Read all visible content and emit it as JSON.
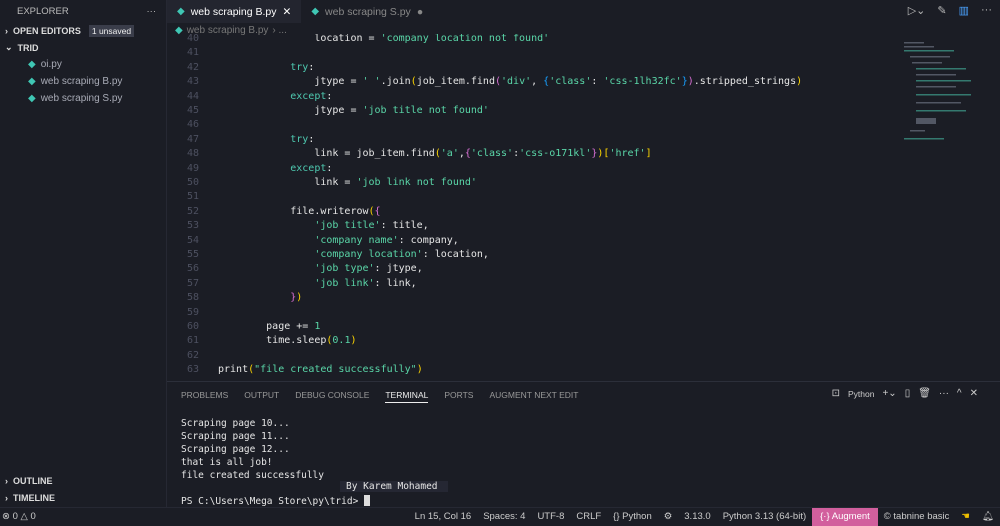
{
  "sidebar": {
    "title": "EXPLORER",
    "more": "···",
    "open_editors": "OPEN EDITORS",
    "unsaved_badge": "1 unsaved",
    "folder": "TRID",
    "files": [
      "oi.py",
      "web scraping B.py",
      "web scraping S.py"
    ],
    "outline": "OUTLINE",
    "timeline": "TIMELINE"
  },
  "tabs": [
    {
      "label": "web scraping B.py",
      "close": "✕"
    },
    {
      "label": "web scraping S.py",
      "dirty": "●"
    }
  ],
  "breadcrumb": {
    "file": "web scraping B.py",
    "rest": "› ..."
  },
  "code": [
    {
      "n": "40",
      "t": [
        [
          "                location = ",
          "n"
        ],
        [
          "'company location not found'",
          "s"
        ]
      ]
    },
    {
      "n": "41",
      "t": []
    },
    {
      "n": "42",
      "t": [
        [
          "            try",
          "k"
        ],
        [
          ":",
          "n"
        ]
      ]
    },
    {
      "n": "43",
      "t": [
        [
          "                jtype = ",
          "n"
        ],
        [
          "' '",
          "s"
        ],
        [
          ".join",
          "n"
        ],
        [
          "(",
          "p1"
        ],
        [
          "job_item.find",
          "n"
        ],
        [
          "(",
          "p2"
        ],
        [
          "'div'",
          "s"
        ],
        [
          ", ",
          "n"
        ],
        [
          "{",
          "p3"
        ],
        [
          "'class'",
          "s"
        ],
        [
          ": ",
          "n"
        ],
        [
          "'css-1lh32fc'",
          "s"
        ],
        [
          "}",
          "p3"
        ],
        [
          ")",
          "p2"
        ],
        [
          ".stripped_strings",
          "n"
        ],
        [
          ")",
          "p1"
        ]
      ]
    },
    {
      "n": "44",
      "t": [
        [
          "            except",
          "k"
        ],
        [
          ":",
          "n"
        ]
      ]
    },
    {
      "n": "45",
      "t": [
        [
          "                jtype = ",
          "n"
        ],
        [
          "'job title not found'",
          "s"
        ]
      ]
    },
    {
      "n": "46",
      "t": []
    },
    {
      "n": "47",
      "t": [
        [
          "            try",
          "k"
        ],
        [
          ":",
          "n"
        ]
      ]
    },
    {
      "n": "48",
      "t": [
        [
          "                link = job_item.find",
          "n"
        ],
        [
          "(",
          "p1"
        ],
        [
          "'a'",
          "s"
        ],
        [
          ",",
          "n"
        ],
        [
          "{",
          "p2"
        ],
        [
          "'class'",
          "s"
        ],
        [
          ":",
          "n"
        ],
        [
          "'css-o171kl'",
          "s"
        ],
        [
          "}",
          "p2"
        ],
        [
          ")",
          "p1"
        ],
        [
          "[",
          "p1"
        ],
        [
          "'href'",
          "s"
        ],
        [
          "]",
          "p1"
        ]
      ]
    },
    {
      "n": "49",
      "t": [
        [
          "            except",
          "k"
        ],
        [
          ":",
          "n"
        ]
      ]
    },
    {
      "n": "50",
      "t": [
        [
          "                link = ",
          "n"
        ],
        [
          "'job link not found'",
          "s"
        ]
      ]
    },
    {
      "n": "51",
      "t": []
    },
    {
      "n": "52",
      "t": [
        [
          "            file.writerow",
          "n"
        ],
        [
          "(",
          "p1"
        ],
        [
          "{",
          "p2"
        ]
      ]
    },
    {
      "n": "53",
      "t": [
        [
          "                ",
          "n"
        ],
        [
          "'job title'",
          "s"
        ],
        [
          ": title,",
          "n"
        ]
      ]
    },
    {
      "n": "54",
      "t": [
        [
          "                ",
          "n"
        ],
        [
          "'company name'",
          "s"
        ],
        [
          ": company,",
          "n"
        ]
      ]
    },
    {
      "n": "55",
      "t": [
        [
          "                ",
          "n"
        ],
        [
          "'company location'",
          "s"
        ],
        [
          ": location,",
          "n"
        ]
      ]
    },
    {
      "n": "56",
      "t": [
        [
          "                ",
          "n"
        ],
        [
          "'job type'",
          "s"
        ],
        [
          ": jtype,",
          "n"
        ]
      ]
    },
    {
      "n": "57",
      "t": [
        [
          "                ",
          "n"
        ],
        [
          "'job link'",
          "s"
        ],
        [
          ": link,",
          "n"
        ]
      ]
    },
    {
      "n": "58",
      "t": [
        [
          "            ",
          "n"
        ],
        [
          "}",
          "p2"
        ],
        [
          ")",
          "p1"
        ]
      ]
    },
    {
      "n": "59",
      "t": []
    },
    {
      "n": "60",
      "t": [
        [
          "        page += ",
          "n"
        ],
        [
          "1",
          "num"
        ]
      ]
    },
    {
      "n": "61",
      "t": [
        [
          "        time.sleep",
          "n"
        ],
        [
          "(",
          "p1"
        ],
        [
          "0.1",
          "num"
        ],
        [
          ")",
          "p1"
        ]
      ]
    },
    {
      "n": "62",
      "t": []
    },
    {
      "n": "63",
      "t": [
        [
          "print",
          "n"
        ],
        [
          "(",
          "p1"
        ],
        [
          "\"file created successfully\"",
          "s"
        ],
        [
          ")",
          "p1"
        ]
      ]
    }
  ],
  "panel": {
    "tabs": [
      "PROBLEMS",
      "OUTPUT",
      "DEBUG CONSOLE",
      "TERMINAL",
      "PORTS",
      "AUGMENT NEXT EDIT"
    ],
    "active": "TERMINAL",
    "shell": "Python",
    "lines": [
      "Scraping page 10...",
      "Scraping page 11...",
      "Scraping page 12...",
      "that is all job!",
      "file created successfully"
    ],
    "tooltip": "By Karem Mohamed",
    "prompt": "PS C:\\Users\\Mega Store\\py\\trid> "
  },
  "status": {
    "errors": "0",
    "warnings": "0",
    "position": "Ln 15, Col 16",
    "spaces": "Spaces: 4",
    "encoding": "UTF-8",
    "eol": "CRLF",
    "language": "{} Python",
    "version": "3.13.0",
    "interpreter": "Python 3.13 (64-bit)",
    "augment": "{·} Augment",
    "tabnine": "© tabnine basic"
  },
  "colors": {
    "accent": "#d25f9d",
    "keyword": "#4ec9b0",
    "string": "#5ad6a8"
  }
}
